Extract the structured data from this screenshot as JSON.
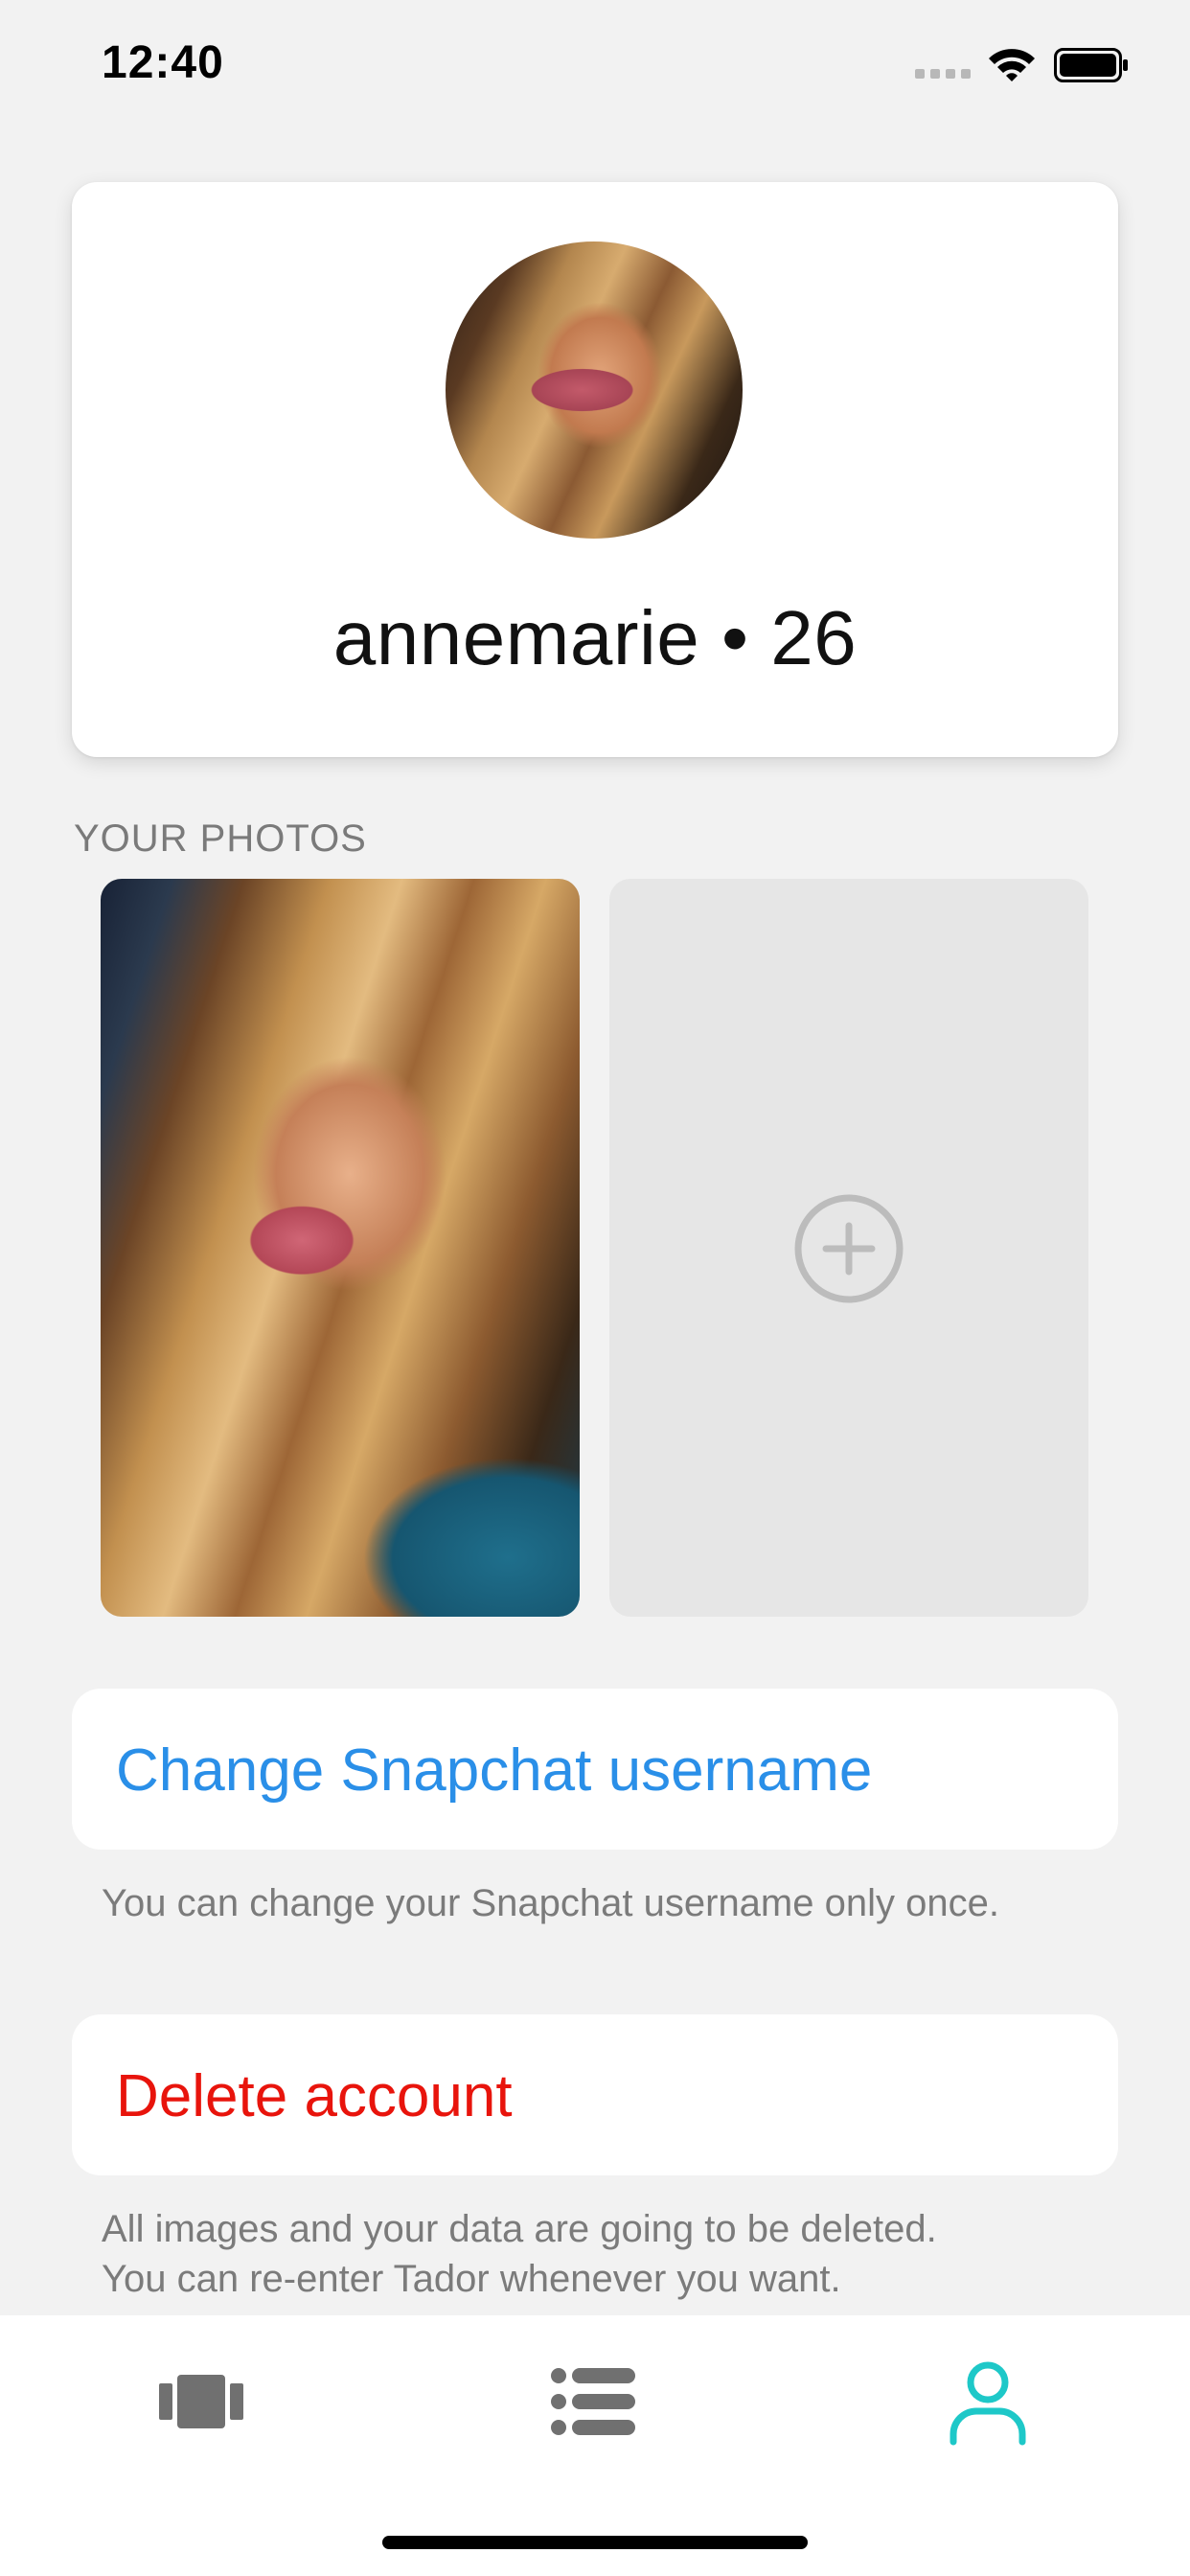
{
  "status_bar": {
    "time": "12:40",
    "icons": [
      "signal-icon",
      "wifi-icon",
      "battery-icon"
    ]
  },
  "profile": {
    "name": "annemarie • 26",
    "avatar": "avatar-photo"
  },
  "photos": {
    "section_title": "YOUR PHOTOS",
    "items": [
      {
        "type": "photo"
      },
      {
        "type": "add",
        "icon": "plus-circle-icon"
      }
    ]
  },
  "actions": {
    "change_username": {
      "label": "Change Snapchat username",
      "note": "You can change your Snapchat username only once.",
      "color": "#2a8fe8"
    },
    "delete_account": {
      "label": "Delete account",
      "note_line1": "All images and your data are going to be deleted.",
      "note_line2": "You can re-enter Tador whenever you want.",
      "color": "#e8140c"
    }
  },
  "tab_bar": {
    "tabs": [
      {
        "icon": "cards-icon",
        "active": false
      },
      {
        "icon": "list-icon",
        "active": false
      },
      {
        "icon": "profile-icon",
        "active": true
      }
    ],
    "active_color": "#1ec8c8",
    "inactive_color": "#707070"
  }
}
